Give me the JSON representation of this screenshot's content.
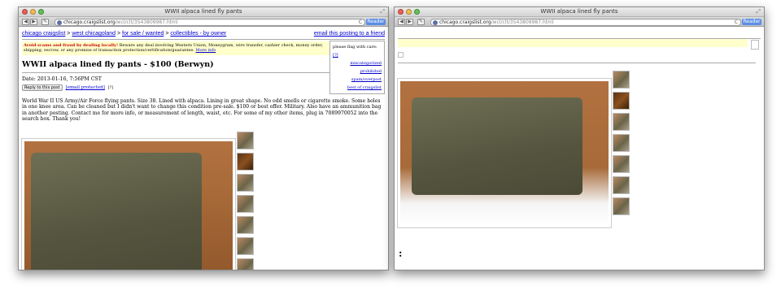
{
  "window": {
    "title": "WWII alpaca lined fly pants",
    "url_host": "chicago.craigslist.org",
    "url_path": "/wcl/clt/3543809987.html",
    "reader_label": "Reader"
  },
  "breadcrumb": {
    "site": "chicago craigslist",
    "area": "west chicagoland",
    "section": "for sale / wanted",
    "category": "collectibles - by owner",
    "email_link": "email this posting to a friend"
  },
  "warning": {
    "strong": "Avoid scams and fraud by dealing locally!",
    "text": "Beware any deal involving Western Union, Moneygram, wire transfer, cashier check, money order, shipping, escrow, or any promise of transaction protection/certification/guarantee.",
    "link": "More info"
  },
  "flag": {
    "heading": "please flag with care:",
    "help": "[?]",
    "items": [
      "miscategorized",
      "prohibited",
      "spam/overpost",
      "best of craigslist"
    ]
  },
  "posting": {
    "title": "WWII alpaca lined fly pants - $100 (Berwyn)",
    "date": "Date: 2013-01-16, 7:56PM CST",
    "reply_button": "Reply to this post",
    "reply_email": "[email protected]",
    "reply_superscript": "[?]",
    "body": "World War II US Army/Air Force flying pants. Size 38. Lined with alpaca. Lining in great shape. No odd smells or cigarette smoke. Some holes in one knee area. Can be cleaned but I didn't want to change this condition pre-sale. $100 or best offer. Military. Also have an ammunition bag in another posting. Contact me for more info, or measurement of length, waist, etc. For some of my other items, plug in 7089970052 into the search box. Thank you!"
  },
  "right_page": {
    "stray_text": ":"
  }
}
